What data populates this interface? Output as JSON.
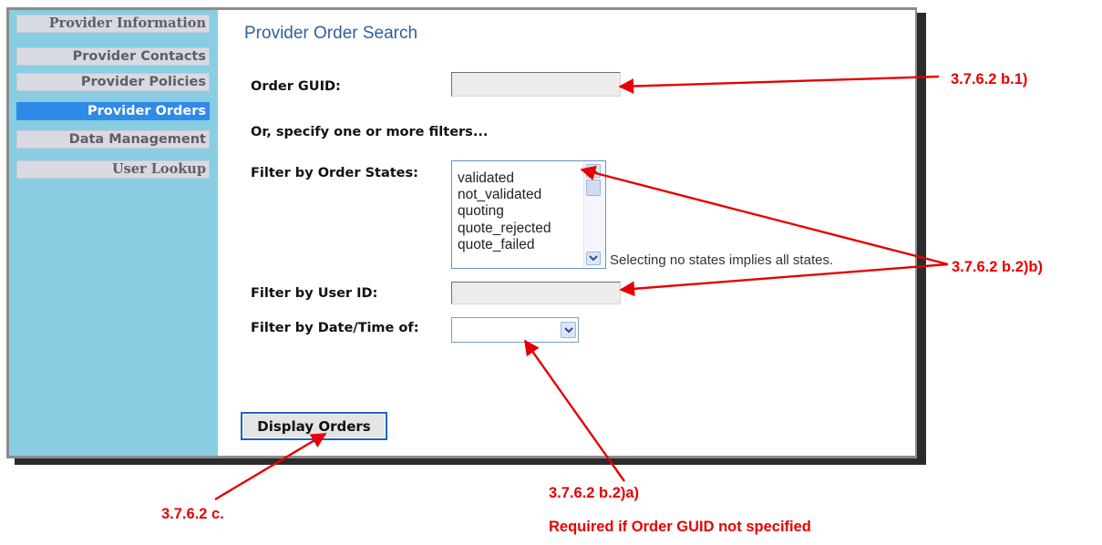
{
  "sidebar": {
    "items": [
      {
        "label": "Provider Information",
        "active": false
      },
      {
        "label": "Provider Contacts",
        "active": false
      },
      {
        "label": "Provider Policies",
        "active": false
      },
      {
        "label": "Provider Orders",
        "active": true
      },
      {
        "label": "Data Management",
        "active": false
      },
      {
        "label": "User Lookup",
        "active": false
      }
    ]
  },
  "main": {
    "title": "Provider Order Search",
    "order_guid": {
      "label": "Order GUID:",
      "value": ""
    },
    "filters_intro": "Or, specify one or more filters...",
    "order_states": {
      "label": "Filter by Order States:",
      "options": [
        "validated",
        "not_validated",
        "quoting",
        "quote_rejected",
        "quote_failed"
      ],
      "hint": "Selecting no states implies all states."
    },
    "user_id": {
      "label": "Filter by User ID:",
      "value": ""
    },
    "date_time": {
      "label": "Filter by Date/Time of:",
      "selected": ""
    },
    "display_button": "Display Orders"
  },
  "annotations": {
    "guid_ref": "3.7.6.2 b.1)",
    "filters_ref": "3.7.6.2 b.2)b)",
    "date_ref": "3.7.6.2 b.2)a)",
    "date_note": "Required if Order GUID not specified",
    "button_ref": "3.7.6.2 c."
  },
  "colors": {
    "sidebar_bg": "#89cde3",
    "active_item": "#2f8ae8",
    "title": "#2d5fa3",
    "annotation": "#e60000"
  }
}
